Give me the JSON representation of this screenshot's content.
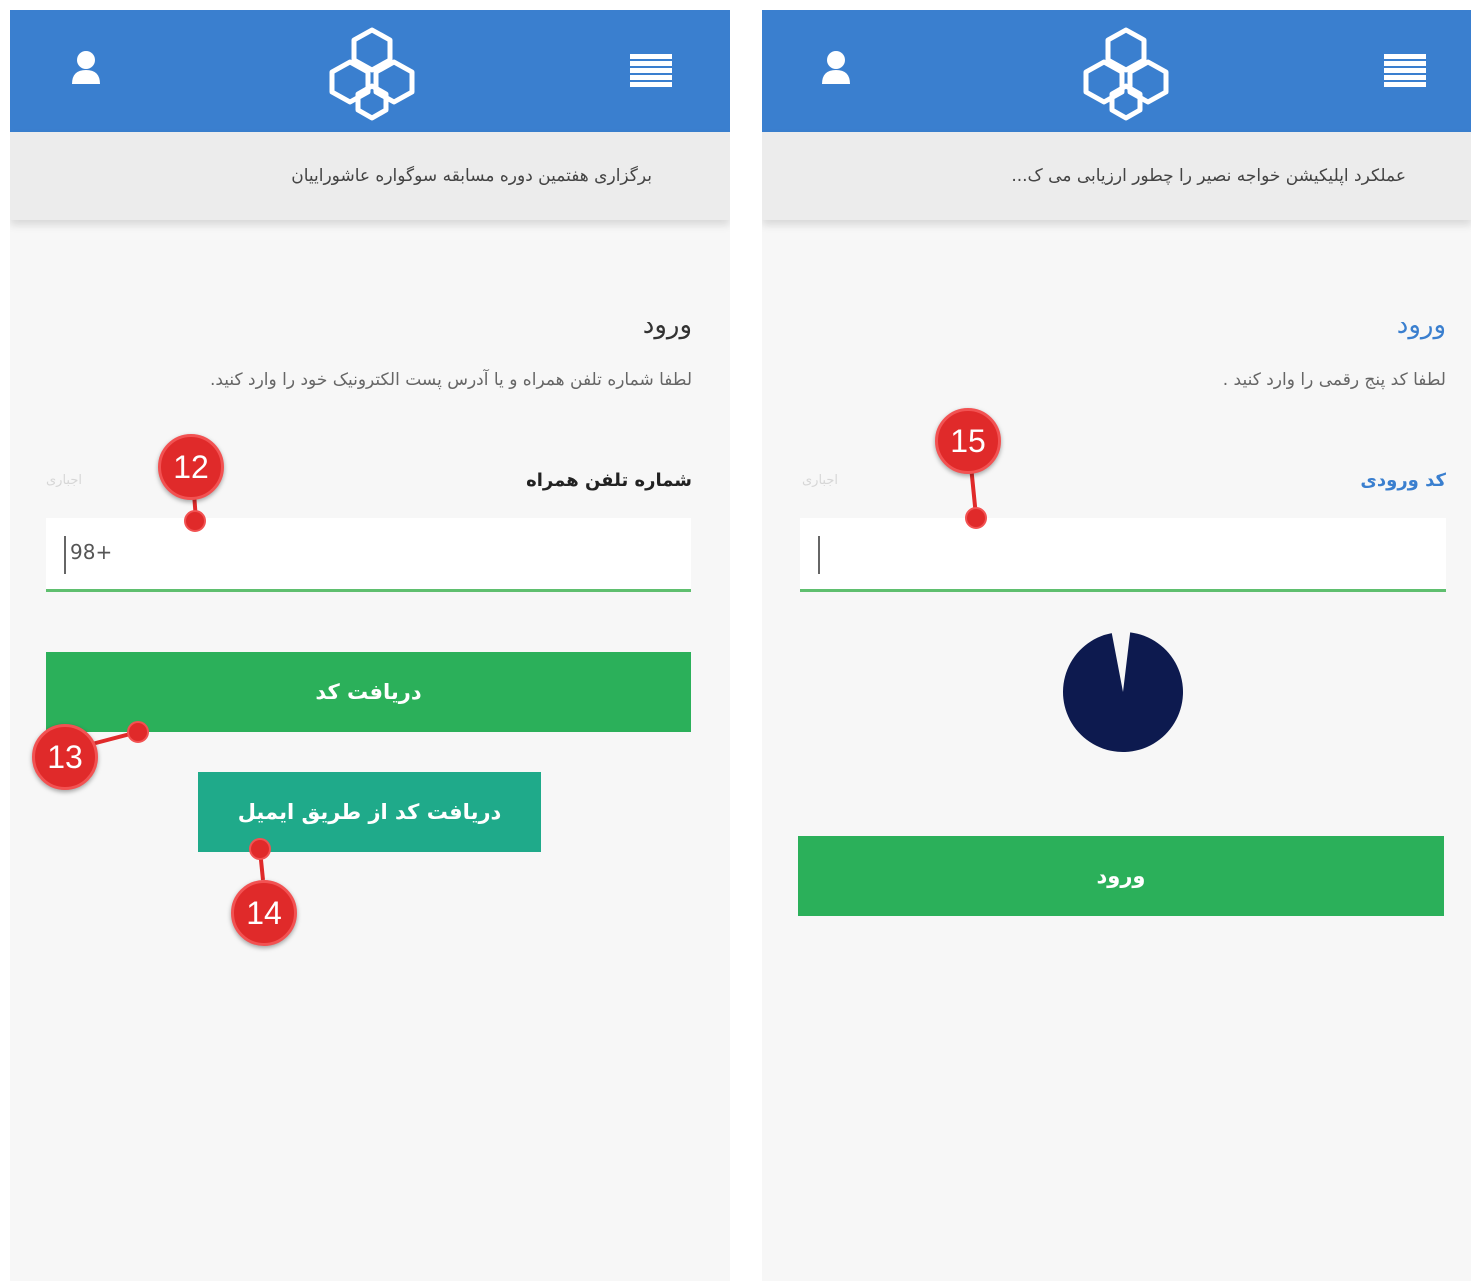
{
  "left_screen": {
    "header": {
      "menu_icon": "menu-list-icon",
      "logo_icon": "university-logo-icon",
      "user_icon": "user-icon"
    },
    "news_ticker": "برگزاری هفتمین دوره مسابقه سوگواره عاشوراییان",
    "title": "ورود",
    "instruction": "لطفا شماره تلفن همراه و یا آدرس پست الکترونیک خود را وارد کنید.",
    "phone_field": {
      "label": "شماره تلفن همراه",
      "hint": "اجباری",
      "value": "98+"
    },
    "get_code_button": "دریافت کد",
    "email_code_button": "دریافت کد از طریق ایمیل",
    "callouts": [
      "12",
      "13",
      "14"
    ]
  },
  "right_screen": {
    "header": {
      "menu_icon": "menu-list-icon",
      "logo_icon": "university-logo-icon",
      "user_icon": "user-icon"
    },
    "news_ticker": "عملکرد اپلیکیشن خواجه نصیر را چطور ارزیابی می ک...",
    "title": "ورود",
    "instruction": "لطفا کد پنج رقمی را وارد کنید .",
    "code_field": {
      "label": "کد ورودی",
      "hint": "اجباری",
      "value": ""
    },
    "loading_progress": 0.97,
    "login_button": "ورود",
    "callouts": [
      "15"
    ]
  },
  "colors": {
    "header_blue": "#3a7fcf",
    "button_green": "#2bb05a",
    "button_teal": "#1faa8a",
    "callout_red": "#e02a2a",
    "spinner_navy": "#0d1a4f"
  }
}
